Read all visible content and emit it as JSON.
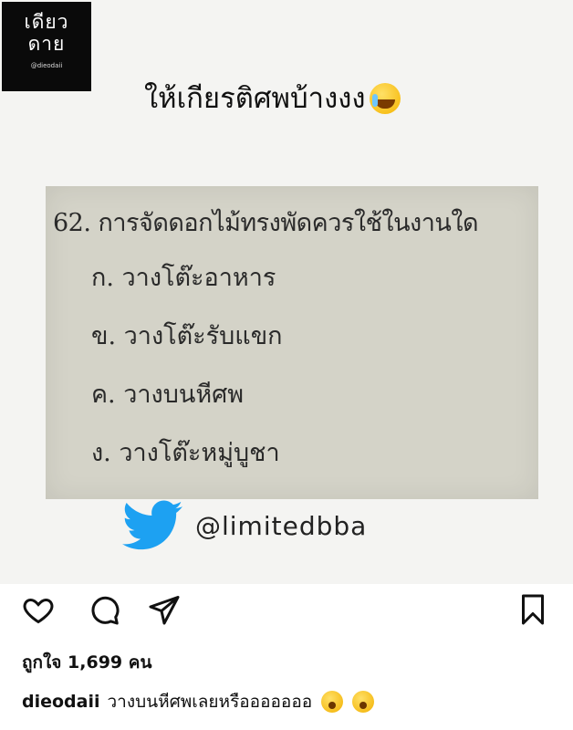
{
  "logo": {
    "line1": "เดียว",
    "line2": "ดาย",
    "handle": "@dieodaii"
  },
  "headline": {
    "text": "ให้เกียรติศพบ้างงง",
    "emoji": "crying-laughing-emoji"
  },
  "exam": {
    "question": "62. การจัดดอกไม้ทรงพัดควรใช้ในงานใด",
    "options": [
      "ก. วางโต๊ะอาหาร",
      "ข. วางโต๊ะรับแขก",
      "ค. วางบนหีศพ",
      "ง. วางโต๊ะหมู่บูชา"
    ]
  },
  "twitter": {
    "handle": "@limitedbba",
    "icon": "twitter-bird-icon",
    "color": "#1da1f2"
  },
  "actions": {
    "like_icon": "heart-icon",
    "comment_icon": "comment-icon",
    "share_icon": "send-icon",
    "save_icon": "bookmark-icon"
  },
  "likes": {
    "text": "ถูกใจ 1,699 คน"
  },
  "caption": {
    "username": "dieodaii",
    "text": "วางบนหีศพเลยหรือออออออ",
    "emoji": "astonished-emoji"
  }
}
